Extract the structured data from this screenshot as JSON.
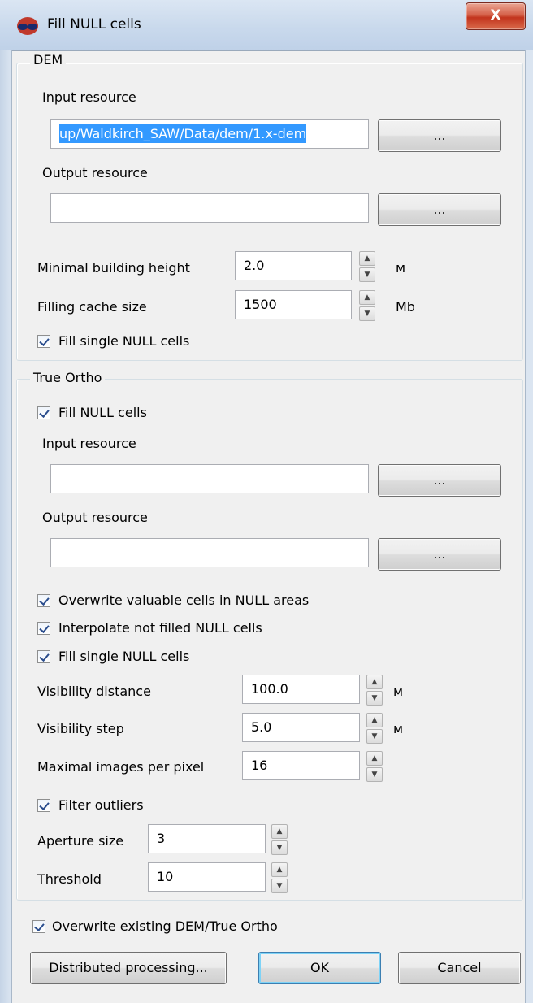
{
  "window": {
    "title": "Fill NULL cells",
    "close_label": "X"
  },
  "dem": {
    "group_title": "DEM",
    "input_label": "Input resource",
    "input_value": "up/Waldkirch_SAW/Data/dem/1.x-dem",
    "browse_label": "...",
    "output_label": "Output resource",
    "output_value": "",
    "min_building_label": "Minimal building height",
    "min_building_value": "2.0",
    "min_building_unit": "м",
    "cache_label": "Filling cache size",
    "cache_value": "1500",
    "cache_unit": "Mb",
    "fill_single_label": "Fill single NULL cells",
    "fill_single_checked": true
  },
  "ortho": {
    "group_title": "True Ortho",
    "fill_null_label": "Fill NULL cells",
    "fill_null_checked": true,
    "input_label": "Input resource",
    "input_value": "",
    "output_label": "Output resource",
    "output_value": "",
    "browse_label": "...",
    "overwrite_valuable_label": "Overwrite valuable cells in NULL areas",
    "interpolate_label": "Interpolate not filled NULL cells",
    "fill_single_label": "Fill single NULL cells",
    "vis_distance_label": "Visibility distance",
    "vis_distance_value": "100.0",
    "vis_distance_unit": "м",
    "vis_step_label": "Visibility step",
    "vis_step_value": "5.0",
    "vis_step_unit": "м",
    "max_images_label": "Maximal images per pixel",
    "max_images_value": "16",
    "filter_outliers_label": "Filter outliers",
    "aperture_label": "Aperture size",
    "aperture_value": "3",
    "threshold_label": "Threshold",
    "threshold_value": "10"
  },
  "footer": {
    "overwrite_existing_label": "Overwrite existing DEM/True Ortho",
    "distributed_label": "Distributed processing...",
    "ok_label": "OK",
    "cancel_label": "Cancel"
  }
}
